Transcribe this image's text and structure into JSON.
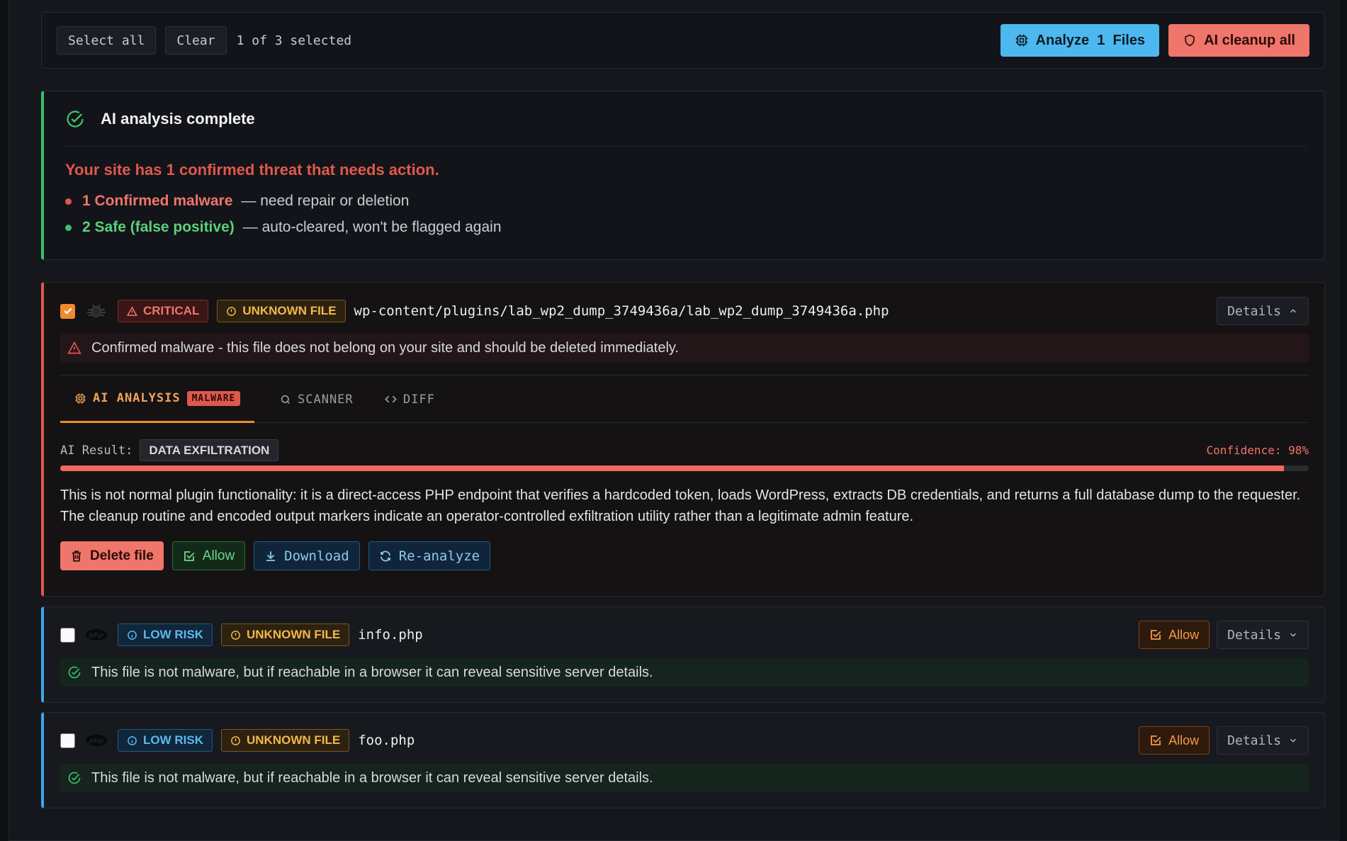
{
  "toolbar": {
    "select_all": "Select all",
    "clear": "Clear",
    "selection_status": "1 of 3 selected",
    "analyze_label": "Analyze  1  Files",
    "cleanup_label": "AI cleanup all"
  },
  "summary": {
    "title": "AI analysis complete",
    "headline": "Your site has 1 confirmed threat that needs action.",
    "items": [
      {
        "label": "1 Confirmed malware",
        "detail": "— need repair or deletion",
        "color": "#f0756a"
      },
      {
        "label": "2 Safe (false positive)",
        "detail": "— auto-cleared, won't be flagged again",
        "color": "#5ad17a"
      }
    ]
  },
  "files": [
    {
      "checked": true,
      "icon": "bug-icon",
      "severity": "CRITICAL",
      "type": "UNKNOWN FILE",
      "path": "wp-content/plugins/lab_wp2_dump_3749436a/lab_wp2_dump_3749436a.php",
      "details_label": "Details",
      "message": "Confirmed malware - this file does not belong on your site and should be deleted immediately.",
      "tabs": [
        {
          "label": "AI ANALYSIS",
          "badge": "MALWARE",
          "active": true
        },
        {
          "label": "SCANNER",
          "active": false
        },
        {
          "label": "DIFF",
          "active": false
        }
      ],
      "ai_result_label": "AI Result:",
      "ai_result": "DATA EXFILTRATION",
      "confidence_label": "Confidence: 98%",
      "confidence": 0.98,
      "explanation": "This is not normal plugin functionality: it is a direct-access PHP endpoint that verifies a hardcoded token, loads WordPress, extracts DB credentials, and returns a full database dump to the requester. The cleanup routine and encoded output markers indicate an operator-controlled exfiltration utility rather than a legitimate admin feature.",
      "actions": [
        "Delete file",
        "Allow",
        "Download",
        "Re-analyze"
      ]
    },
    {
      "checked": false,
      "icon": "php-icon",
      "severity": "LOW RISK",
      "type": "UNKNOWN FILE",
      "path": "info.php",
      "allow_label": "Allow",
      "details_label": "Details",
      "message": "This file is not malware, but if reachable in a browser it can reveal sensitive server details."
    },
    {
      "checked": false,
      "icon": "php-icon",
      "severity": "LOW RISK",
      "type": "UNKNOWN FILE",
      "path": "foo.php",
      "allow_label": "Allow",
      "details_label": "Details",
      "message": "This file is not malware, but if reachable in a browser it can reveal sensitive server details."
    }
  ]
}
